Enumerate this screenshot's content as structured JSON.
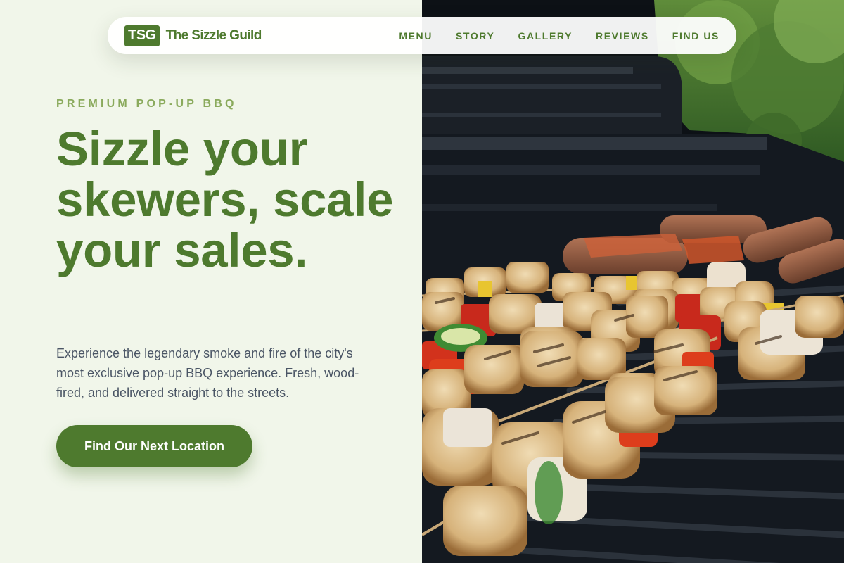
{
  "brand": {
    "badge": "TSG",
    "name": "The Sizzle Guild"
  },
  "nav": {
    "items": [
      {
        "label": "MENU"
      },
      {
        "label": "STORY"
      },
      {
        "label": "GALLERY"
      },
      {
        "label": "REVIEWS"
      },
      {
        "label": "FIND US"
      }
    ]
  },
  "hero": {
    "eyebrow": "PREMIUM POP-UP BBQ",
    "headline": "Sizzle your skewers, scale your sales.",
    "description": "Experience the legendary smoke and fire of the city's most exclusive pop-up BBQ experience. Fresh, wood-fired, and delivered straight to the streets.",
    "cta_label": "Find Our Next Location",
    "image_subject": "skewers-and-sausages-on-grill"
  },
  "colors": {
    "brand_green": "#4e7a2e",
    "eyebrow_green": "#8aaa5c",
    "background": "#f1f6ea",
    "body_text": "#4a5565"
  }
}
